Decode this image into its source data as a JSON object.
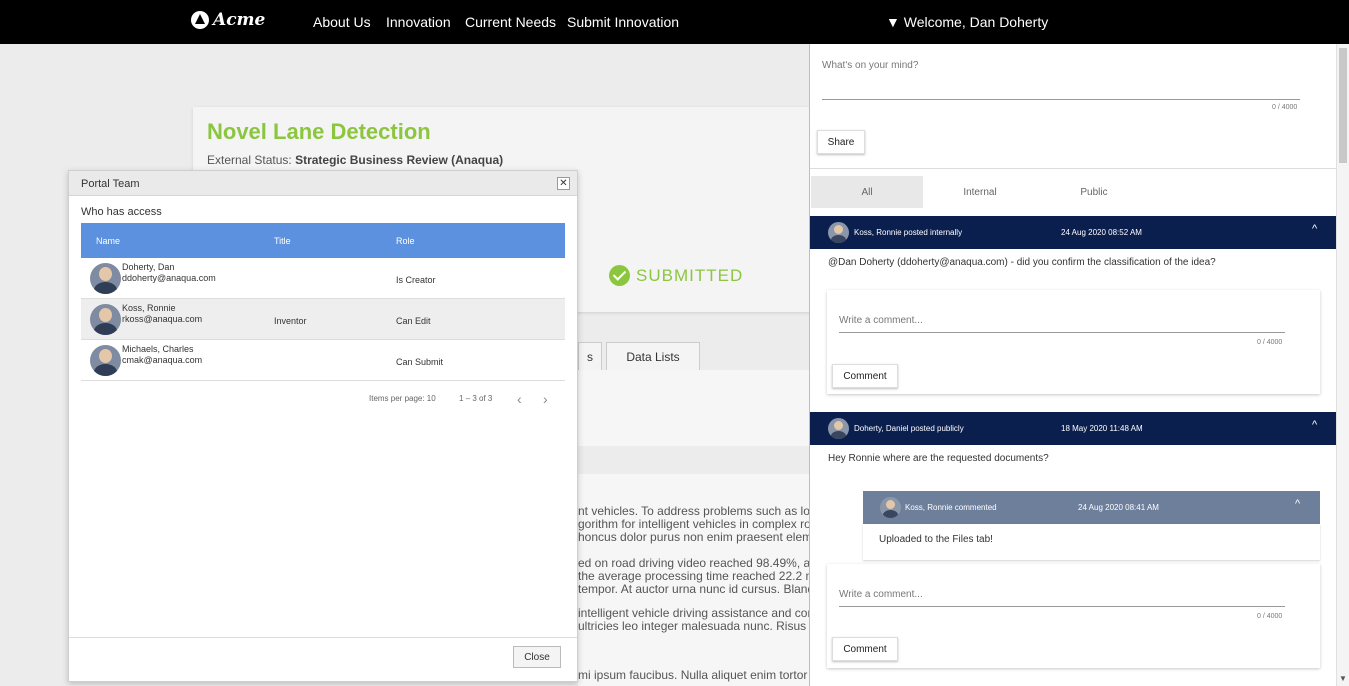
{
  "nav": {
    "logo_text": "Acme",
    "items": [
      "About Us",
      "Innovation",
      "Current Needs",
      "Submit Innovation"
    ],
    "welcome": "▼ Welcome, Dan Doherty"
  },
  "idea": {
    "title": "Novel Lane Detection",
    "status_label": "External Status:",
    "status_value": "Strategic Business Review (Anaqua)",
    "stage": "SUBMITTED",
    "tab_partial": "s",
    "tab_data_lists": "Data Lists",
    "body_lines": [
      "nt vehicles. To address problems such as low c",
      "gorithm for intelligent vehicles in complex road",
      "honcus dolor purus non enim praesent element",
      "ed on road driving video reached 98.49%, and t",
      " the average processing time reached 22.2 ms",
      " tempor. At auctor urna nunc id cursus. Blandit",
      " intelligent vehicle driving assistance and condu",
      "ultricies leo integer malesuada nunc. Risus con",
      " mi ipsum faucibus. Nulla aliquet enim tortor at"
    ]
  },
  "modal": {
    "title": "Portal Team",
    "close_x": "✕",
    "who_label": "Who has access",
    "columns": [
      "Name",
      "Title",
      "Role"
    ],
    "rows": [
      {
        "name": "Doherty, Dan",
        "email": "ddoherty@anaqua.com",
        "title": "",
        "role": "Is Creator"
      },
      {
        "name": "Koss, Ronnie",
        "email": "rkoss@anaqua.com",
        "title": "Inventor",
        "role": "Can Edit"
      },
      {
        "name": "Michaels, Charles",
        "email": "cmak@anaqua.com",
        "title": "",
        "role": "Can Submit"
      }
    ],
    "items_per_page": "Items per page: 10",
    "range": "1 – 3 of 3",
    "prev": "‹",
    "next": "›",
    "close_button": "Close"
  },
  "feed": {
    "mind_placeholder": "What's on your mind?",
    "mind_counter": "0 / 4000",
    "share_button": "Share",
    "filters": [
      "All",
      "Internal",
      "Public"
    ],
    "posts": [
      {
        "author": "Koss, Ronnie posted internally",
        "date": "24 Aug 2020 08:52 AM",
        "text": "@Dan Doherty (ddoherty@anaqua.com) - did you confirm the classification of the idea?",
        "comment_placeholder": "Write a comment...",
        "counter": "0 / 4000",
        "comment_button": "Comment"
      },
      {
        "author": "Doherty, Daniel posted publicly",
        "date": "18 May 2020 11:48 AM",
        "text": "Hey Ronnie where are the requested documents?",
        "reply": {
          "author": "Koss, Ronnie commented",
          "date": "24 Aug 2020 08:41 AM",
          "text": "Uploaded to the Files tab!"
        },
        "comment_placeholder": "Write a comment...",
        "counter": "0 / 4000",
        "comment_button": "Comment"
      }
    ],
    "chevron": "^"
  },
  "colors": {
    "accent_green": "#8cc63f",
    "table_header_blue": "#5b91df",
    "post_bar_navy": "#0b1f4f",
    "reply_bar": "#6e7f9c"
  }
}
